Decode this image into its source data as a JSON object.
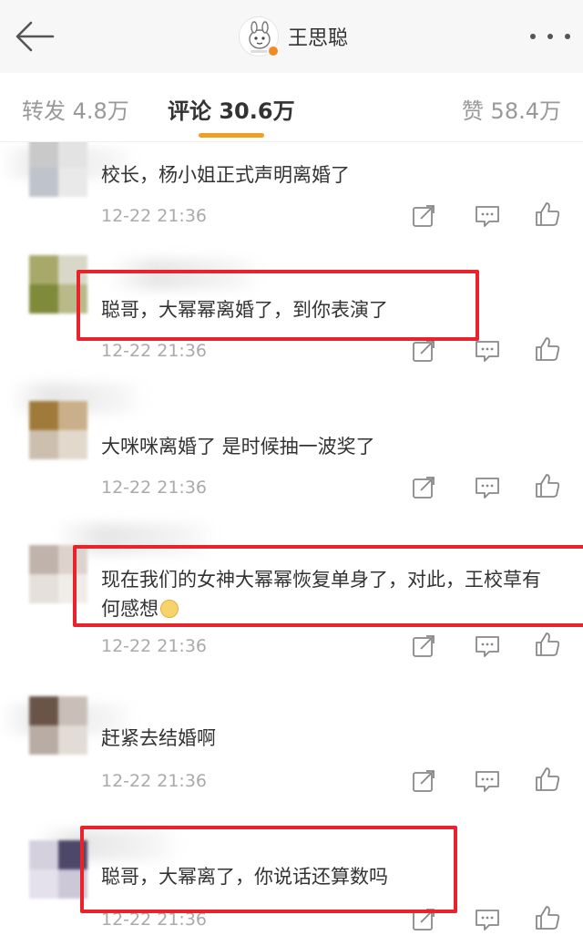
{
  "header": {
    "title": "王思聪",
    "back_icon": "arrow-left-icon",
    "more_icon": "more-dots-icon",
    "avatar_icon": "cartoon-avatar-icon"
  },
  "tabs": {
    "repost_label": "转发 4.8万",
    "comment_label": "评论 30.6万",
    "like_label": "赞 58.4万",
    "active_color": "#f0a020"
  },
  "comments": [
    {
      "text": "校长，杨小姐正式声明离婚了",
      "time": "12-22 21:36",
      "highlighted": false
    },
    {
      "text": "聪哥，大幂幂离婚了，到你表演了",
      "time": "12-22 21:36",
      "highlighted": true
    },
    {
      "text": "大咪咪离婚了 是时候抽一波奖了",
      "time": "12-22 21:36",
      "highlighted": false
    },
    {
      "text": "现在我们的女神大幂幂恢复单身了，对此，王校草有何感想",
      "time": "12-22 21:36",
      "highlighted": true
    },
    {
      "text": "赶紧去结婚啊",
      "time": "12-22 21:36",
      "highlighted": false
    },
    {
      "text": "聪哥，大幂离了，你说话还算数吗",
      "time": "12-22 21:36",
      "highlighted": true
    }
  ],
  "actions": {
    "share_icon": "share-icon",
    "reply_icon": "comment-icon",
    "like_icon": "thumbs-up-icon"
  },
  "colors": {
    "highlight_box": "#e8232b",
    "time_text": "#aaaaaa"
  }
}
